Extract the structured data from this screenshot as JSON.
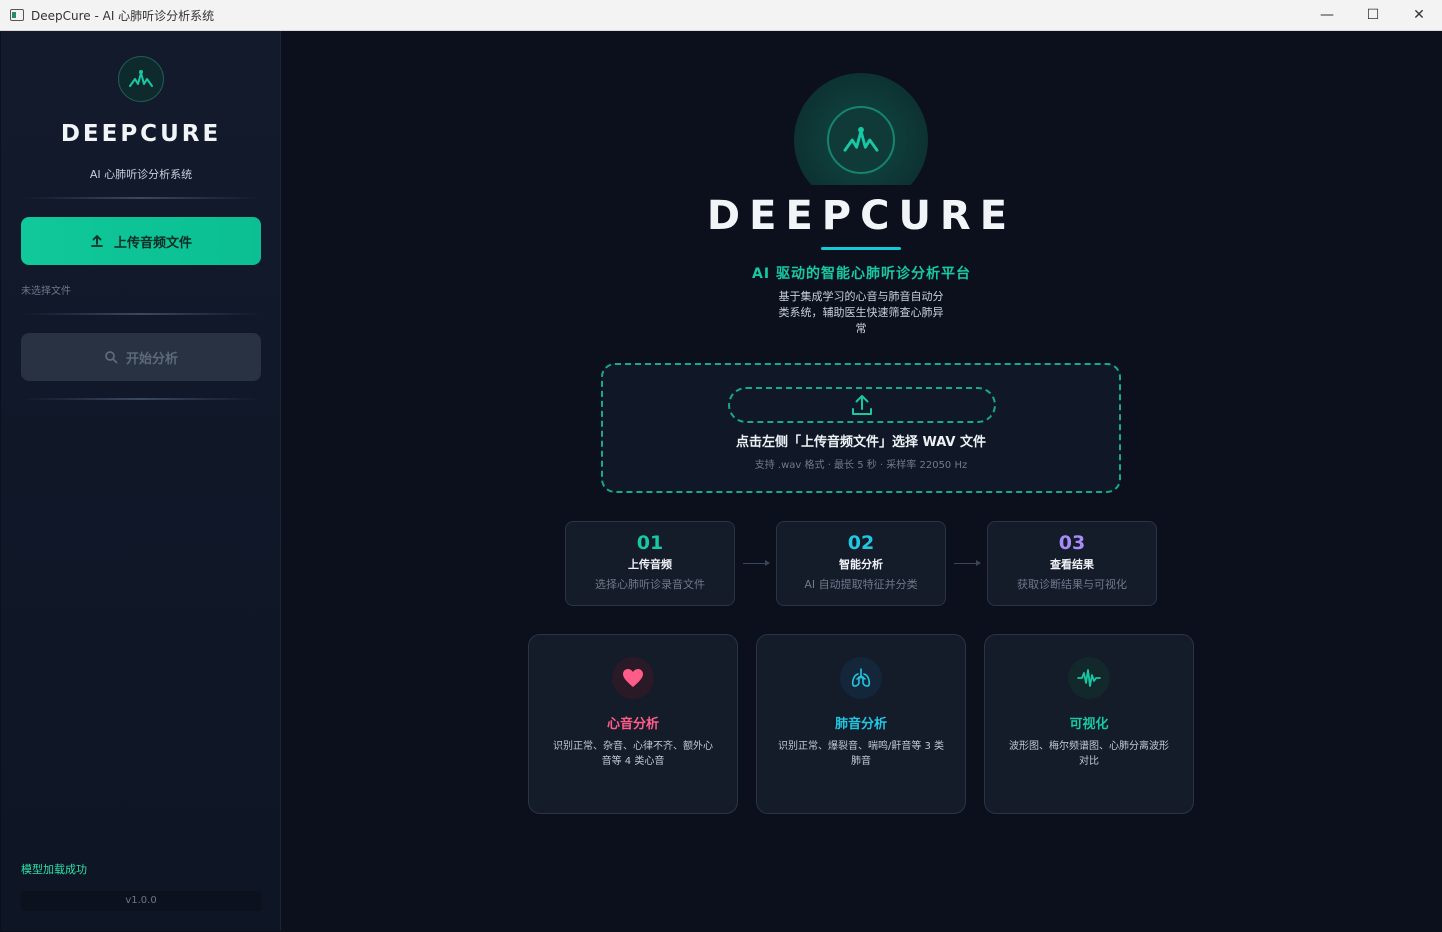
{
  "window": {
    "title": "DeepCure - AI 心肺听诊分析系统",
    "controls": {
      "minimize": "—",
      "maximize": "☐",
      "close": "✕"
    }
  },
  "sidebar": {
    "brand": "DEEPCURE",
    "subtitle": "AI 心肺听诊分析系统",
    "upload_label": "上传音频文件",
    "file_status": "未选择文件",
    "analyze_label": "开始分析",
    "model_status": "模型加载成功",
    "version": "v1.0.0"
  },
  "hero": {
    "title": "DEEPCURE",
    "tagline": "AI 驱动的智能心肺听诊分析平台",
    "description": "基于集成学习的心音与肺音自动分类系统，辅助医生快速筛查心肺异常"
  },
  "dropzone": {
    "title": "点击左侧「上传音频文件」选择 WAV 文件",
    "meta": "支持 .wav 格式 · 最长 5 秒 · 采样率 22050 Hz"
  },
  "steps": [
    {
      "num": "01",
      "label": "上传音频",
      "sub": "选择心肺听诊录音文件",
      "color": "#18c8a4"
    },
    {
      "num": "02",
      "label": "智能分析",
      "sub": "AI 自动提取特征并分类",
      "color": "#22c6e0"
    },
    {
      "num": "03",
      "label": "查看结果",
      "sub": "获取诊断结果与可视化",
      "color": "#a58cf7"
    }
  ],
  "features": [
    {
      "title": "心音分析",
      "desc": "识别正常、杂音、心律不齐、额外心音等 4 类心音",
      "color": "#ff5c8a",
      "icon": "heart-icon"
    },
    {
      "title": "肺音分析",
      "desc": "识别正常、爆裂音、喘鸣/鼾音等 3 类肺音",
      "color": "#22c6e0",
      "icon": "lungs-icon"
    },
    {
      "title": "可视化",
      "desc": "波形图、梅尔频谱图、心肺分离波形对比",
      "color": "#18c8a4",
      "icon": "waveform-icon"
    }
  ],
  "colors": {
    "accent": "#10c89a",
    "sidebar_bg": "#121a2c",
    "main_bg": "#0b101c"
  }
}
